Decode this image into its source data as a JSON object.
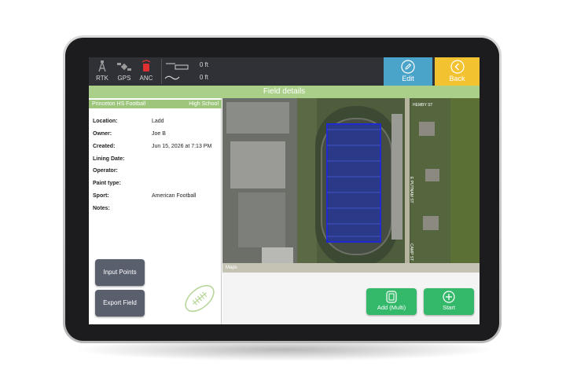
{
  "status": {
    "rtk_label": "RTK",
    "gps_label": "GPS",
    "anc_label": "ANC",
    "meter_top": "0 ft",
    "meter_bottom": "0 ft"
  },
  "toolbar": {
    "edit_label": "Edit",
    "back_label": "Back"
  },
  "title": "Field details",
  "field": {
    "name": "Princeton HS Football",
    "type": "High School",
    "rows": [
      {
        "key": "Location:",
        "value": "Ladd"
      },
      {
        "key": "Owner:",
        "value": "Joe B"
      },
      {
        "key": "Created:",
        "value": "Jun 15, 2026 at 7:13 PM"
      },
      {
        "key": "Lining Date:",
        "value": ""
      },
      {
        "key": "Operator:",
        "value": ""
      },
      {
        "key": "Paint type:",
        "value": ""
      },
      {
        "key": "Sport:",
        "value": "American Football"
      },
      {
        "key": "Notes:",
        "value": ""
      }
    ]
  },
  "actions": {
    "input_points": "Input Points",
    "export_field": "Export Field",
    "add_multi": "Add (Multi)",
    "start": "Start"
  },
  "map": {
    "attribution": "Maps",
    "street_labels": [
      "HEMBY ST",
      "E PUTNAM ST",
      "CAMP ST"
    ]
  },
  "colors": {
    "topbar": "#2f3137",
    "edit": "#4aa3c8",
    "back": "#f2c230",
    "title": "#a9cf89",
    "green_button": "#34b86a",
    "gray_button": "#5a5f6e",
    "field_outline": "#1f2ad0"
  }
}
